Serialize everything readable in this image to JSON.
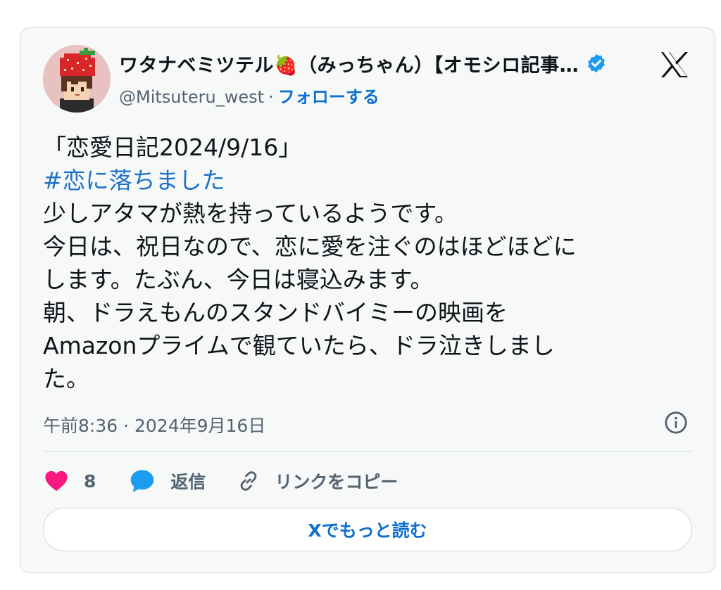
{
  "author": {
    "display_name": "ワタナベミツテル🍓（みっちゃん）【オモシロ記事…",
    "handle": "@Mitsuteru_west",
    "separator": "·",
    "follow_label": "フォローする",
    "verified_icon": "verified-badge-icon",
    "avatar": "pixel-strawberry-hat-avatar"
  },
  "platform_logo": "x-logo-icon",
  "post": {
    "lines": [
      {
        "text": "「恋愛日記2024/9/16」",
        "type": "text"
      },
      {
        "text": "#恋に落ちました",
        "type": "hashtag"
      },
      {
        "text": "少しアタマが熱を持っているようです。",
        "type": "text"
      },
      {
        "text": "今日は、祝日なので、恋に愛を注ぐのはほどほどに",
        "type": "text"
      },
      {
        "text": "します。たぶん、今日は寝込みます。",
        "type": "text"
      },
      {
        "text": "朝、ドラえもんのスタンドバイミーの映画を",
        "type": "text"
      },
      {
        "text": "Amazonプライムで観ていたら、ドラ泣きしまし",
        "type": "text"
      },
      {
        "text": "た。",
        "type": "text"
      }
    ],
    "timestamp": "午前8:36 · 2024年9月16日"
  },
  "actions": {
    "like_icon": "heart-icon",
    "like_count": "8",
    "reply_icon": "speech-bubble-icon",
    "reply_label": "返信",
    "copy_icon": "link-icon",
    "copy_label": "リンクをコピー"
  },
  "read_more_label": "Xでもっと読む",
  "colors": {
    "link_blue": "#0f6fce",
    "hashtag_blue": "#1d72c9",
    "heart_pink": "#f91880",
    "reply_blue": "#1d9bf0",
    "verified_blue": "#1d9bf0",
    "muted_text": "#536471",
    "border": "#cfd9de"
  }
}
